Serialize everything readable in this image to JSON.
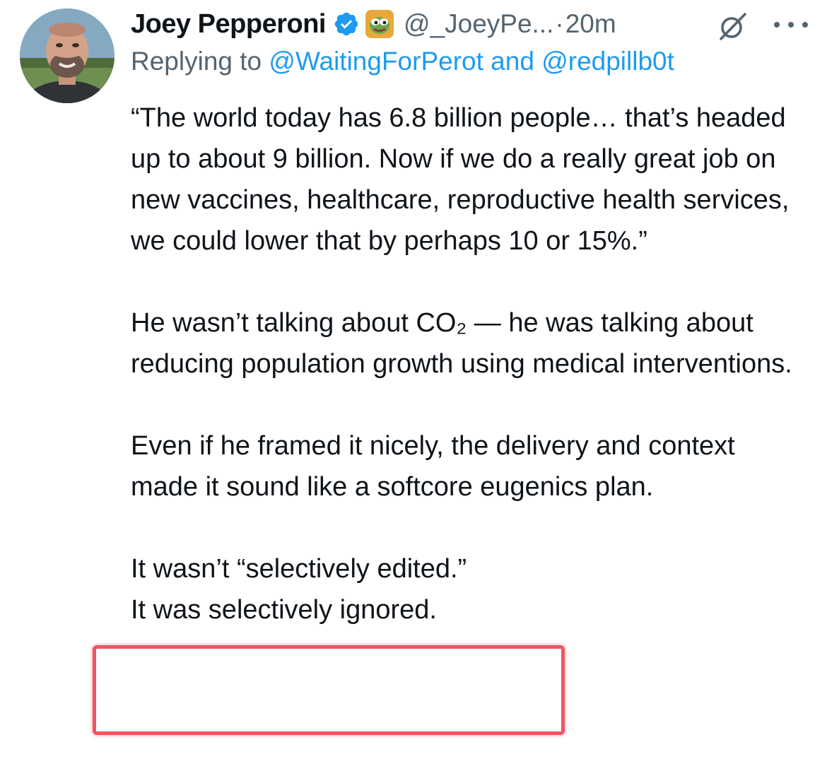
{
  "tweet": {
    "author": {
      "display_name": "Joey Pepperoni",
      "handle": "@_JoeyPe...",
      "verified_icon": "verified-badge-icon",
      "affiliation_icon": "pepe-frog-icon"
    },
    "separator": "·",
    "timestamp": "20m",
    "reply": {
      "prefix": "Replying to ",
      "mention_1": "@WaitingForPerot",
      "joiner": " and ",
      "mention_2": "@redpillb0t"
    },
    "paragraphs": [
      "“The world today has 6.8 billion people… that’s headed up to about 9 billion. Now if we do a really great job on new vaccines, healthcare, reproductive health services, we could lower that by perhaps 10 or 15%.”",
      "He wasn’t talking about CO₂ — he was talking about reducing population growth using medical interventions.",
      "Even if he framed it nicely, the delivery and context made it sound like a softcore eugenics plan.",
      "It wasn’t “selectively edited.”",
      "It was selectively ignored."
    ],
    "colors": {
      "text": "#0f1419",
      "secondary": "#536471",
      "link": "#1d9bf0",
      "verified": "#1d9bf0",
      "highlight": "#ee5560"
    }
  }
}
